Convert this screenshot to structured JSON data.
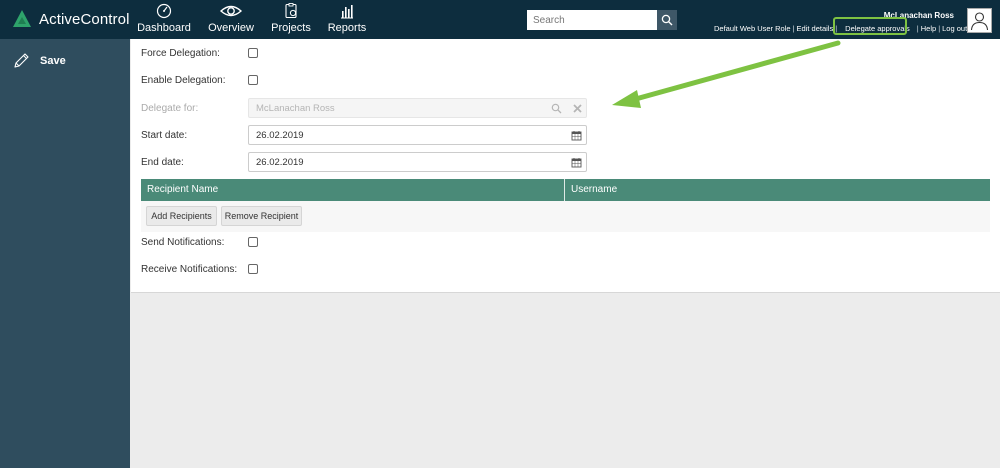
{
  "app": {
    "name": "ActiveControl",
    "brand_color": "#2ea36b",
    "topbar_color": "#0d2d3e",
    "sidebar_color": "#2f4d5e"
  },
  "nav": {
    "items": [
      {
        "label": "Dashboard",
        "icon": "gauge-icon"
      },
      {
        "label": "Overview",
        "icon": "eye-icon"
      },
      {
        "label": "Projects",
        "icon": "clipboard-icon"
      },
      {
        "label": "Reports",
        "icon": "bar-chart-icon"
      }
    ]
  },
  "search": {
    "placeholder": "Search",
    "icon": "search-icon"
  },
  "user": {
    "name": "McLanachan Ross",
    "role": "Default Web User Role",
    "links": {
      "edit_details": "Edit details",
      "delegate_approvals": "Delegate approvals",
      "help": "Help",
      "log_out": "Log out"
    },
    "separator": "|",
    "avatar_icon": "user-avatar-icon"
  },
  "sidebar": {
    "save_label": "Save",
    "save_icon": "pencil-icon"
  },
  "form": {
    "force_delegation": {
      "label": "Force Delegation:",
      "checked": false
    },
    "enable_delegation": {
      "label": "Enable Delegation:",
      "checked": false
    },
    "delegate_for": {
      "label": "Delegate for:",
      "value": "McLanachan Ross",
      "disabled": true
    },
    "start_date": {
      "label": "Start date:",
      "value": "26.02.2019"
    },
    "end_date": {
      "label": "End date:",
      "value": "26.02.2019"
    },
    "recipients_table": {
      "columns": [
        "Recipient Name",
        "Username"
      ],
      "header_color": "#4a8a78",
      "rows": []
    },
    "add_recipients_label": "Add Recipients",
    "remove_recipient_label": "Remove Recipient",
    "send_notifications": {
      "label": "Send Notifications:",
      "checked": false
    },
    "receive_notifications": {
      "label": "Receive Notifications:",
      "checked": false
    }
  },
  "annotation": {
    "highlight_color": "#7ec242"
  }
}
